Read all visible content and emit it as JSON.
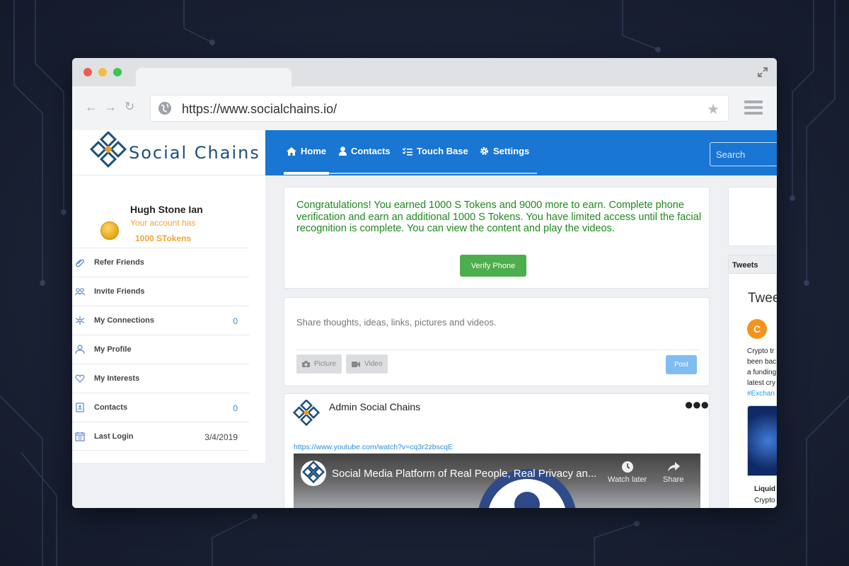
{
  "browser": {
    "url": "https://www.socialchains.io/"
  },
  "brand": {
    "name": "Social Chains"
  },
  "nav": {
    "items": [
      {
        "label": "Home",
        "icon": "home-icon"
      },
      {
        "label": "Contacts",
        "icon": "user-icon"
      },
      {
        "label": "Touch Base",
        "icon": "list-icon"
      },
      {
        "label": "Settings",
        "icon": "gear-icon"
      }
    ],
    "search_placeholder": "Search"
  },
  "profile": {
    "name": "Hugh Stone Ian",
    "account_label": "Your account has",
    "tokens": "1000 STokens"
  },
  "sidebar": {
    "items": [
      {
        "label": "Refer Friends",
        "value": ""
      },
      {
        "label": "Invite Friends",
        "value": ""
      },
      {
        "label": "My Connections",
        "value": "0"
      },
      {
        "label": "My Profile",
        "value": ""
      },
      {
        "label": "My Interests",
        "value": ""
      },
      {
        "label": "Contacts",
        "value": "0"
      },
      {
        "label": "Last Login",
        "value": "3/4/2019"
      }
    ]
  },
  "congrats": {
    "message": "Congratulations! You earned 1000 S Tokens and 9000 more to earn. Complete phone verification and earn an additional 1000 S Tokens. You have limited access until the facial recognition is complete. You can view the content and play the videos.",
    "button": "Verify Phone"
  },
  "share": {
    "placeholder": "Share thoughts, ideas, links, pictures and videos.",
    "picture": "Picture",
    "video": "Video",
    "post": "Post"
  },
  "post": {
    "author": "Admin Social Chains",
    "link": "https://www.youtube.com/watch?v=cq3r2zbscqE",
    "video_title": "Social Media Platform of Real People, Real Privacy an...",
    "watch_later": "Watch later",
    "share": "Share"
  },
  "tweets": {
    "header": "Tweets",
    "title": "Twee",
    "avatar_letter": "C",
    "lines": [
      "Crypto tr",
      "been bac",
      "a funding",
      "latest cry"
    ],
    "hashtag": "#Exchan",
    "footer_title": "Liquid",
    "footer_sub": "Crypto"
  },
  "colors": {
    "nav_blue": "#1976d2",
    "success_green": "#4cae4c",
    "token_orange": "#f2a533",
    "link_blue": "#2a8ee0"
  }
}
